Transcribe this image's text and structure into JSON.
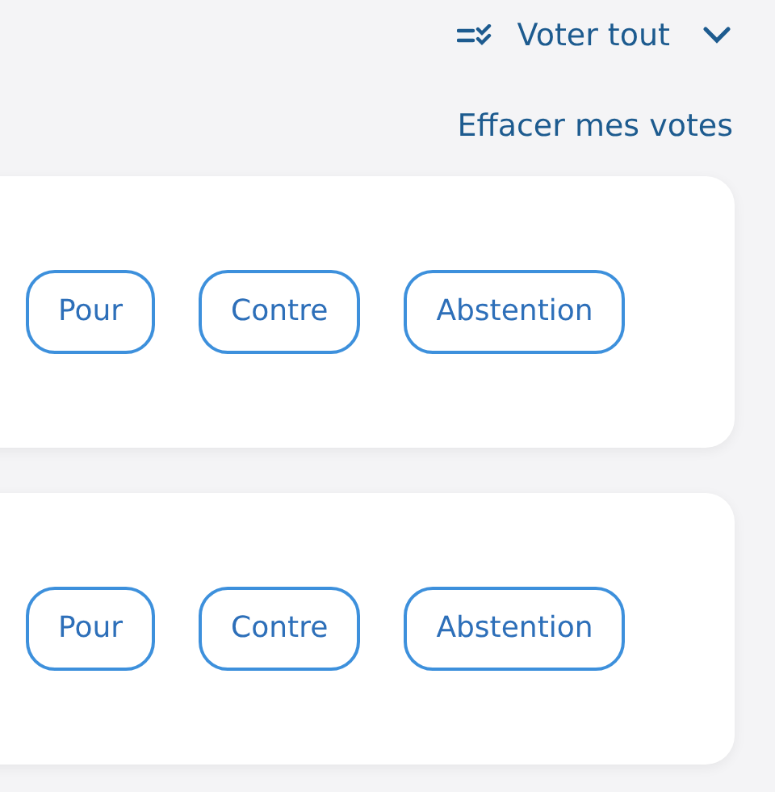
{
  "header": {
    "vote_all": "Voter tout",
    "clear_votes": "Effacer mes votes"
  },
  "cards": [
    {
      "options": [
        {
          "label": "Pour",
          "selected": false
        },
        {
          "label": "Contre",
          "selected": false
        },
        {
          "label": "Abstention",
          "selected": false
        }
      ]
    },
    {
      "options": [
        {
          "label": "Pour",
          "selected": false
        },
        {
          "label": "Contre",
          "selected": false
        },
        {
          "label": "Abstention",
          "selected": false
        }
      ]
    }
  ]
}
